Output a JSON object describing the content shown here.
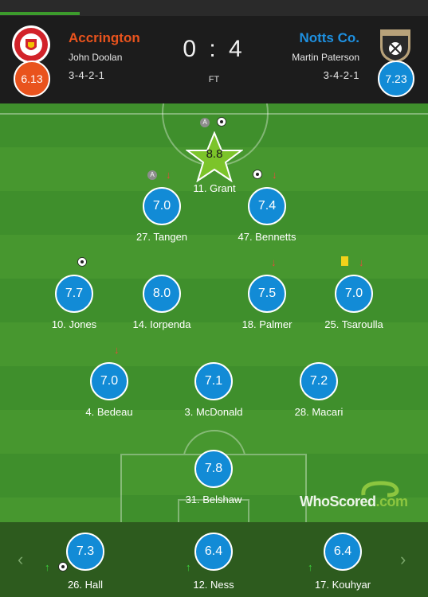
{
  "match": {
    "score": "0 : 4",
    "status": "FT"
  },
  "home": {
    "name": "Accrington",
    "manager": "John Doolan",
    "formation": "3-4-2-1",
    "rating": "6.13",
    "color": "#e9531d"
  },
  "away": {
    "name": "Notts Co.",
    "manager": "Martin Paterson",
    "formation": "3-4-2-1",
    "rating": "7.23",
    "color": "#128bd6"
  },
  "players": {
    "grant": {
      "rating": "8.8",
      "name": "11. Grant"
    },
    "tangen": {
      "rating": "7.0",
      "name": "27. Tangen"
    },
    "bennetts": {
      "rating": "7.4",
      "name": "47. Bennetts"
    },
    "jones": {
      "rating": "7.7",
      "name": "10. Jones"
    },
    "iorpenda": {
      "rating": "8.0",
      "name": "14. Iorpenda"
    },
    "palmer": {
      "rating": "7.5",
      "name": "18. Palmer"
    },
    "tsaroulla": {
      "rating": "7.0",
      "name": "25. Tsaroulla"
    },
    "bedeau": {
      "rating": "7.0",
      "name": "4. Bedeau"
    },
    "mcdonald": {
      "rating": "7.1",
      "name": "3. McDonald"
    },
    "macari": {
      "rating": "7.2",
      "name": "28. Macari"
    },
    "belshaw": {
      "rating": "7.8",
      "name": "31. Belshaw"
    }
  },
  "bench": {
    "hall": {
      "rating": "7.3",
      "name": "26. Hall"
    },
    "ness": {
      "rating": "6.4",
      "name": "12. Ness"
    },
    "kouhyar": {
      "rating": "6.4",
      "name": "17. Kouhyar"
    }
  },
  "icons": {
    "assist": "A",
    "sub_off": "↓",
    "sub_on": "↑",
    "prev": "‹",
    "next": "›"
  },
  "watermark": {
    "part1": "WhoScored",
    "part2": ".com"
  },
  "colors": {
    "player_bubble": "#128bd6",
    "motm_star": "#7cc42a",
    "pitch": "#3f8f2c",
    "bench": "#2d5b1e"
  }
}
